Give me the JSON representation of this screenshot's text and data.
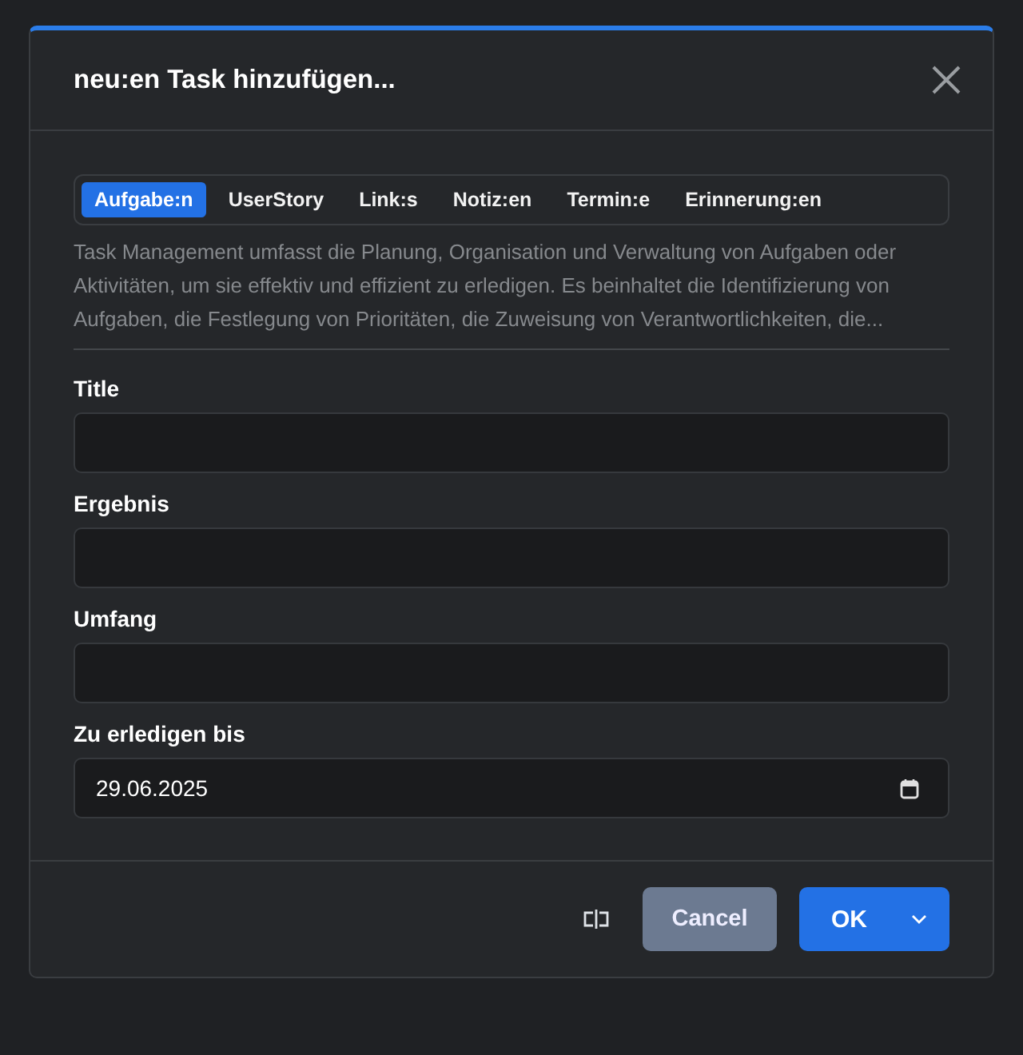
{
  "dialog": {
    "title": "neu:en Task hinzufügen..."
  },
  "tabs": [
    {
      "label": "Aufgabe:n",
      "selected": true
    },
    {
      "label": "UserStory",
      "selected": false
    },
    {
      "label": "Link:s",
      "selected": false
    },
    {
      "label": "Notiz:en",
      "selected": false
    },
    {
      "label": "Termin:e",
      "selected": false
    },
    {
      "label": "Erinnerung:en",
      "selected": false
    }
  ],
  "description": "Task Management umfasst die Planung, Organisation und Verwaltung von Aufgaben oder Aktivitäten, um sie effektiv und effizient zu erledigen. Es beinhaltet die Identifizierung von Aufgaben, die Festlegung von Prioritäten, die Zuweisung von Verantwortlichkeiten, die...",
  "fields": [
    {
      "label": "Title",
      "kind": "text"
    },
    {
      "label": "Ergebnis",
      "kind": "text"
    },
    {
      "label": "Umfang",
      "kind": "text"
    },
    {
      "label": "Zu erledigen bis",
      "kind": "date",
      "value": "29.06.2025"
    }
  ],
  "buttons": {
    "cancel": "Cancel",
    "ok": "OK"
  }
}
